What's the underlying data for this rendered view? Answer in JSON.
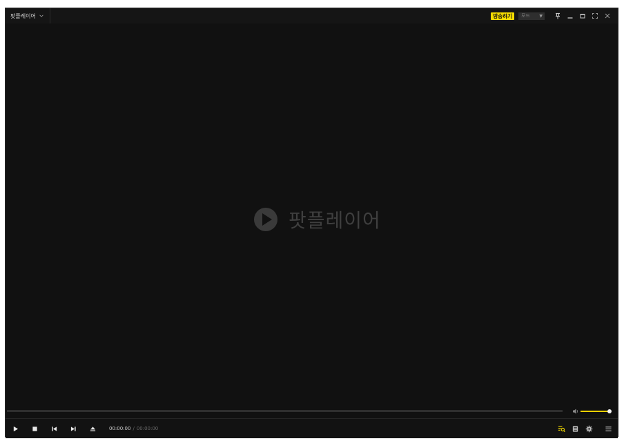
{
  "titlebar": {
    "app_menu_label": "팟플레이어",
    "broadcast_label": "방송하기",
    "mode_label": "모드",
    "icons": [
      "pin-icon",
      "minimize-icon",
      "maximize-icon",
      "fullscreen-icon",
      "close-icon"
    ]
  },
  "video": {
    "logo_text": "팟플레이어"
  },
  "playback": {
    "current_time": "00:00:00",
    "separator": "/",
    "total_time": "00:00:00",
    "volume": 1.0,
    "seek_progress": 0.0
  },
  "colors": {
    "accent": "#f5dc00",
    "background": "#111111",
    "titlebar": "#151515"
  }
}
